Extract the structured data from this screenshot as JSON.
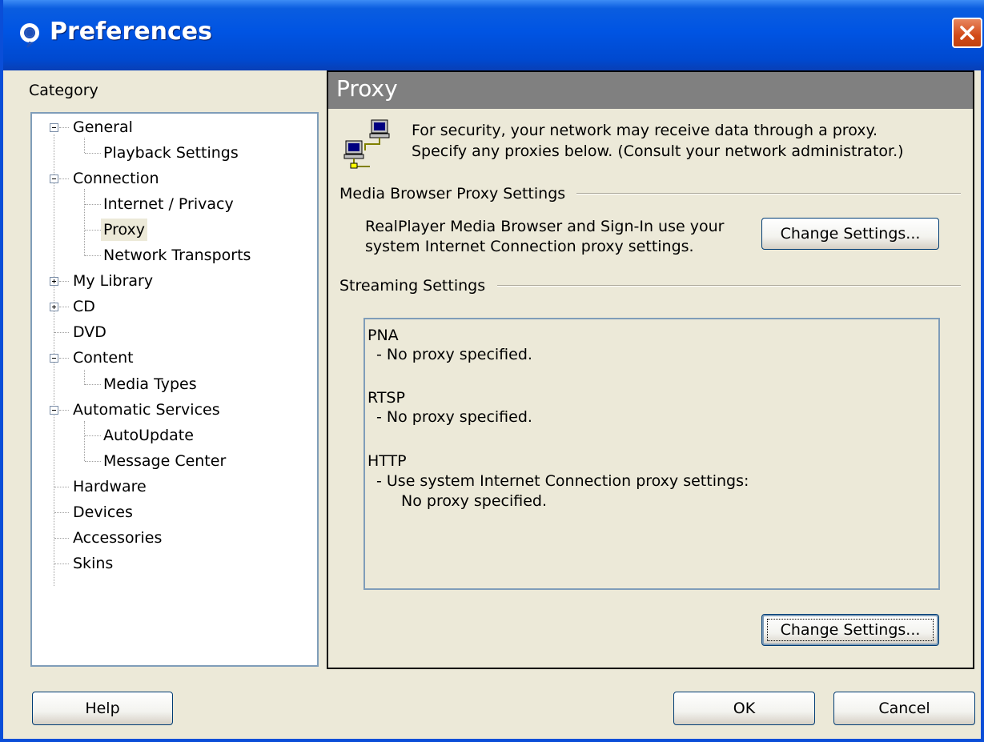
{
  "window": {
    "title": "Preferences",
    "close_icon": "close-icon"
  },
  "category_label": "Category",
  "tree": {
    "items": [
      {
        "label": "General",
        "expander": "minus"
      },
      {
        "label": "Playback Settings"
      },
      {
        "label": "Connection",
        "expander": "minus"
      },
      {
        "label": "Internet / Privacy"
      },
      {
        "label": "Proxy",
        "selected": true
      },
      {
        "label": "Network Transports"
      },
      {
        "label": "My Library",
        "expander": "plus"
      },
      {
        "label": "CD",
        "expander": "plus"
      },
      {
        "label": "DVD"
      },
      {
        "label": "Content",
        "expander": "minus"
      },
      {
        "label": "Media Types"
      },
      {
        "label": "Automatic Services",
        "expander": "minus"
      },
      {
        "label": "AutoUpdate"
      },
      {
        "label": "Message Center"
      },
      {
        "label": "Hardware"
      },
      {
        "label": "Devices"
      },
      {
        "label": "Accessories"
      },
      {
        "label": "Skins"
      }
    ]
  },
  "panel": {
    "header": "Proxy",
    "intro_line1": "For security, your network may receive data through a proxy.",
    "intro_line2": "Specify any proxies below. (Consult your network administrator.)",
    "media_browser": {
      "group_label": "Media Browser Proxy Settings",
      "text_line1": "RealPlayer Media Browser and Sign-In use your",
      "text_line2": "system Internet Connection proxy settings.",
      "button": "Change Settings..."
    },
    "streaming": {
      "group_label": "Streaming Settings",
      "pna_title": "PNA",
      "pna_detail": "- No proxy specified.",
      "rtsp_title": "RTSP",
      "rtsp_detail": "- No proxy specified.",
      "http_title": "HTTP",
      "http_detail": "- Use system Internet Connection proxy settings:",
      "http_detail2": "No proxy specified.",
      "button": "Change Settings..."
    }
  },
  "footer": {
    "help": "Help",
    "ok": "OK",
    "cancel": "Cancel"
  },
  "colors": {
    "titlebar": "#0054e3",
    "panel_header": "#808080",
    "dialog_bg": "#ece9d8"
  }
}
